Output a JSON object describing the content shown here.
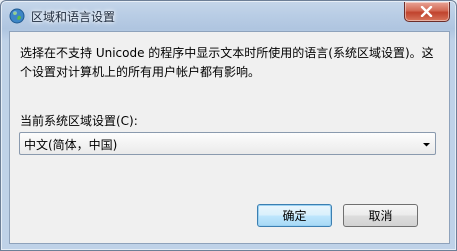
{
  "window": {
    "title": "区域和语言设置",
    "icon": "globe-icon",
    "close_icon": "close-icon"
  },
  "content": {
    "description": "选择在不支持 Unicode 的程序中显示文本时所使用的语言(系统区域设置)。这个设置对计算机上的所有用户帐户都有影响。",
    "locale_label": "当前系统区域设置(C):",
    "locale_value": "中文(简体，中国)"
  },
  "buttons": {
    "ok_label": "确定",
    "cancel_label": "取消"
  },
  "colors": {
    "close_button": "#c0432d",
    "default_button_border": "#3c7fb1"
  }
}
